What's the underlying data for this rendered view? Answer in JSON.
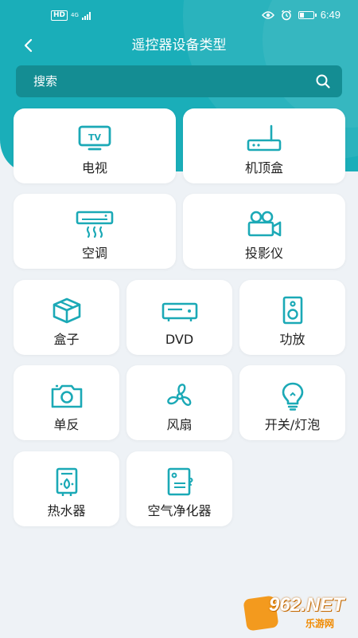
{
  "status_bar": {
    "hd": "HD",
    "network": "4G",
    "time": "6:49"
  },
  "nav": {
    "title": "遥控器设备类型"
  },
  "search": {
    "placeholder": "搜索"
  },
  "devices": [
    {
      "label": "电视",
      "icon": "tv-icon"
    },
    {
      "label": "机顶盒",
      "icon": "set-top-box-icon"
    },
    {
      "label": "空调",
      "icon": "air-conditioner-icon"
    },
    {
      "label": "投影仪",
      "icon": "projector-icon"
    },
    {
      "label": "盒子",
      "icon": "box-icon"
    },
    {
      "label": "DVD",
      "icon": "dvd-player-icon"
    },
    {
      "label": "功放",
      "icon": "speaker-icon"
    },
    {
      "label": "单反",
      "icon": "camera-icon"
    },
    {
      "label": "风扇",
      "icon": "fan-icon"
    },
    {
      "label": "开关/灯泡",
      "icon": "light-bulb-icon"
    },
    {
      "label": "热水器",
      "icon": "water-heater-icon"
    },
    {
      "label": "空气净化器",
      "icon": "air-purifier-icon"
    }
  ],
  "watermark": {
    "number": "962",
    "suffix": ".NET",
    "sub": "乐游网"
  },
  "colors": {
    "accent": "#1aaeb9",
    "search_bg": "#148d93",
    "icon": "#1ba9b6",
    "background": "#eef2f6"
  }
}
